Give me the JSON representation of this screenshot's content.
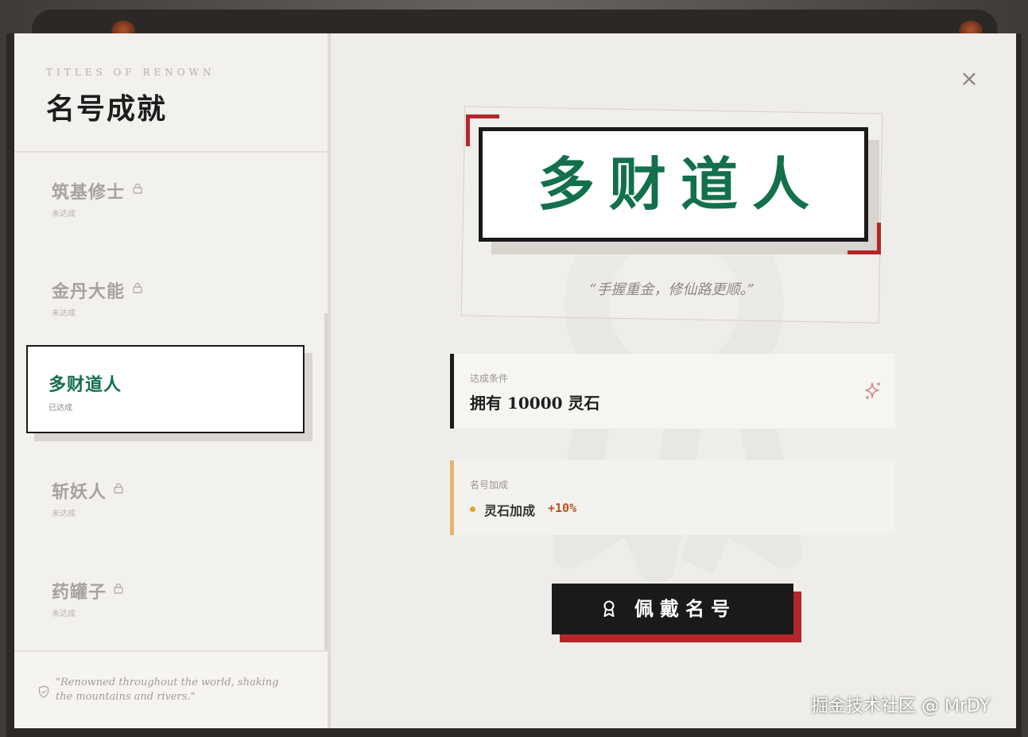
{
  "sidebar": {
    "eyebrow": "TITLES OF RENOWN",
    "title": "名号成就",
    "items": [
      {
        "name": "筑基修士",
        "status": "未达成",
        "locked": true
      },
      {
        "name": "金丹大能",
        "status": "未达成",
        "locked": true
      },
      {
        "name": "多财道人",
        "status": "已达成",
        "locked": false,
        "active": true
      },
      {
        "name": "斩妖人",
        "status": "未达成",
        "locked": true
      },
      {
        "name": "药罐子",
        "status": "未达成",
        "locked": true
      }
    ],
    "footer_quote": "\"Renowned throughout the world, shaking the mountains and rivers.\""
  },
  "detail": {
    "title": "多财道人",
    "motto": "“手握重金，修仙路更顺。”",
    "condition": {
      "label": "达成条件",
      "value": "拥有 10000 灵石"
    },
    "bonus": {
      "label": "名号加成",
      "stat": "灵石加成",
      "value": "+10%"
    },
    "equip_button": "佩戴名号",
    "close_glyph": "×"
  },
  "colors": {
    "accent_green": "#12704a",
    "accent_red": "#b3272a",
    "bonus_orange": "#b5541c",
    "ink": "#1a1a1a"
  },
  "watermark": "掘金技术社区 @ MrDY"
}
